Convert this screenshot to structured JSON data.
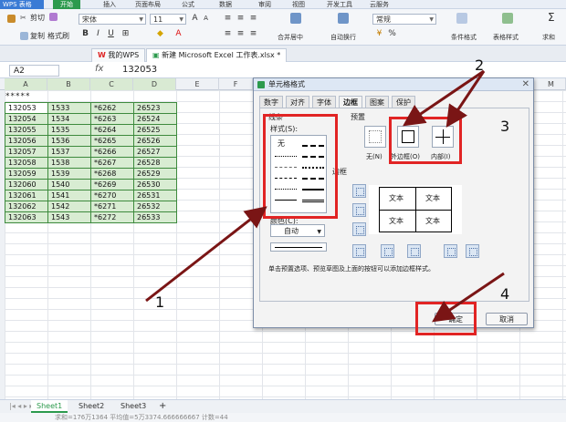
{
  "app": {
    "logo": "WPS 表格",
    "menu": [
      "开始",
      "插入",
      "页面布局",
      "公式",
      "数据",
      "审阅",
      "视图",
      "开发工具",
      "云服务"
    ]
  },
  "ribbon": {
    "cut": "剪切",
    "copy": "复制",
    "format_painter": "格式刷",
    "font_name": "宋体",
    "font_size": "11",
    "merge_center": "合并居中",
    "auto_wrap": "自动换行",
    "number_format": "常规",
    "cond_format": "条件格式",
    "table_style": "表格样式",
    "sum": "求和"
  },
  "doc_tabs": {
    "my_wps": "我的WPS",
    "workbook": "新建 Microsoft Excel 工作表.xlsx *"
  },
  "formula_bar": {
    "name_box": "A2",
    "fx": "fx",
    "value": "132053"
  },
  "columns": [
    "A",
    "B",
    "C",
    "D",
    "E",
    "F",
    "G",
    "H",
    "I",
    "J",
    "K",
    "L",
    "M"
  ],
  "sheet": {
    "header_row": "*****",
    "rows": [
      [
        "132053",
        "1533",
        "*6262",
        "26523"
      ],
      [
        "132054",
        "1534",
        "*6263",
        "26524"
      ],
      [
        "132055",
        "1535",
        "*6264",
        "26525"
      ],
      [
        "132056",
        "1536",
        "*6265",
        "26526"
      ],
      [
        "132057",
        "1537",
        "*6266",
        "26527"
      ],
      [
        "132058",
        "1538",
        "*6267",
        "26528"
      ],
      [
        "132059",
        "1539",
        "*6268",
        "26529"
      ],
      [
        "132060",
        "1540",
        "*6269",
        "26530"
      ],
      [
        "132061",
        "1541",
        "*6270",
        "26531"
      ],
      [
        "132062",
        "1542",
        "*6271",
        "26532"
      ],
      [
        "132063",
        "1543",
        "*6272",
        "26533"
      ]
    ]
  },
  "sheet_tabs": [
    "Sheet1",
    "Sheet2",
    "Sheet3"
  ],
  "status_text": "求和=176万1364   平均值=5万3374.666666667   计数=44",
  "dialog": {
    "title": "单元格格式",
    "tabs": [
      "数字",
      "对齐",
      "字体",
      "边框",
      "图案",
      "保护"
    ],
    "line_group": "线条",
    "style_label": "样式(S):",
    "none_style": "无",
    "color_label": "颜色(C):",
    "color_value": "自动",
    "preset_group": "预置",
    "border_group": "边框",
    "preset_none": "无(N)",
    "preset_outline": "外边框(O)",
    "preset_inside": "内部(I)",
    "preview_text": "文本",
    "hint": "单击预置选项、预览草图及上面的按钮可以添加边框样式。",
    "ok": "确定",
    "cancel": "取消"
  },
  "annotations": [
    "1",
    "2",
    "3",
    "4"
  ],
  "colors": {
    "highlight": "#e12424",
    "arrow": "#7a1515",
    "ribbon_active": "#2c9a4d",
    "selection": "#d8ecd2"
  }
}
